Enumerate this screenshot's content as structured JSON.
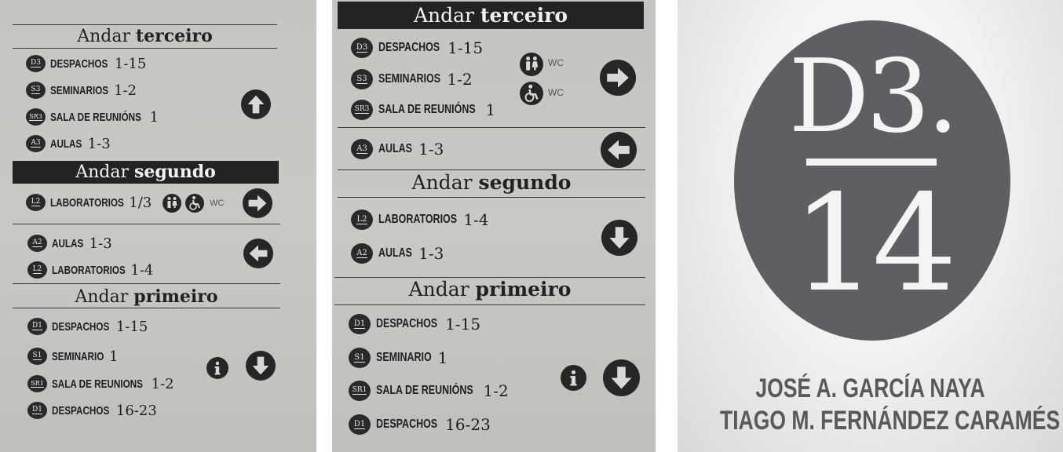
{
  "sign1": {
    "floor3": {
      "prefix": "Andar",
      "name": "terceiro"
    },
    "floor3_rows": [
      {
        "badge": "D3",
        "label": "DESPACHOS",
        "num": "1-15"
      },
      {
        "badge": "S3",
        "label": "SEMINARIOS",
        "num": "1-2"
      },
      {
        "badge": "SR3",
        "label": "SALA DE REUNIÓNS",
        "num": "1"
      },
      {
        "badge": "A3",
        "label": "AULAS",
        "num": "1-3"
      }
    ],
    "floor2": {
      "prefix": "Andar",
      "name": "segundo"
    },
    "floor2_row": {
      "badge": "L2",
      "label": "LABORATORIOS",
      "num": "1/3"
    },
    "wc": "WC",
    "floor2_rows": [
      {
        "badge": "A2",
        "label": "AULAS",
        "num": "1-3"
      },
      {
        "badge": "L2",
        "label": "LABORATORIOS",
        "num": "1-4"
      }
    ],
    "floor1": {
      "prefix": "Andar",
      "name": "primeiro"
    },
    "floor1_rows": [
      {
        "badge": "D1",
        "label": "DESPACHOS",
        "num": "1-15"
      },
      {
        "badge": "S1",
        "label": "SEMINARIO",
        "num": "1"
      },
      {
        "badge": "SR1",
        "label": "SALA DE REUNIONS",
        "num": "1-2"
      },
      {
        "badge": "D1",
        "label": "DESPACHOS",
        "num": "16-23"
      }
    ],
    "icons": [
      "arrow-up-icon",
      "toilet-people-icon",
      "wheelchair-icon",
      "arrow-right-icon",
      "arrow-left-icon",
      "info-icon",
      "arrow-down-icon"
    ]
  },
  "sign2": {
    "floor3": {
      "prefix": "Andar",
      "name": "terceiro"
    },
    "floor3_rows": [
      {
        "badge": "D3",
        "label": "DESPACHOS",
        "num": "1-15"
      },
      {
        "badge": "S3",
        "label": "SEMINARIOS",
        "num": "1-2"
      },
      {
        "badge": "SR3",
        "label": "SALA DE REUNIÓNS",
        "num": "1"
      }
    ],
    "wc": "WC",
    "aulas_row": {
      "badge": "A3",
      "label": "AULAS",
      "num": "1-3"
    },
    "floor2": {
      "prefix": "Andar",
      "name": "segundo"
    },
    "floor2_rows": [
      {
        "badge": "L2",
        "label": "LABORATORIOS",
        "num": "1-4"
      },
      {
        "badge": "A2",
        "label": "AULAS",
        "num": "1-3"
      }
    ],
    "floor1": {
      "prefix": "Andar",
      "name": "primeiro"
    },
    "floor1_rows": [
      {
        "badge": "D1",
        "label": "DESPACHOS",
        "num": "1-15"
      },
      {
        "badge": "S1",
        "label": "SEMINARIO",
        "num": "1"
      },
      {
        "badge": "SR1",
        "label": "SALA DE REUNIÓNS",
        "num": "1-2"
      },
      {
        "badge": "D1",
        "label": "DESPACHOS",
        "num": "16-23"
      }
    ]
  },
  "door": {
    "code": "D3.",
    "room": "14",
    "names": [
      "JOSÉ A. GARCÍA NAYA",
      "TIAGO M. FERNÁNDEZ CARAMÉS"
    ]
  },
  "colors": {
    "sign_bg": "#c6c6c3",
    "ink": "#262626",
    "plate_circle": "#5d5f63",
    "plate_text": "#58595b"
  }
}
